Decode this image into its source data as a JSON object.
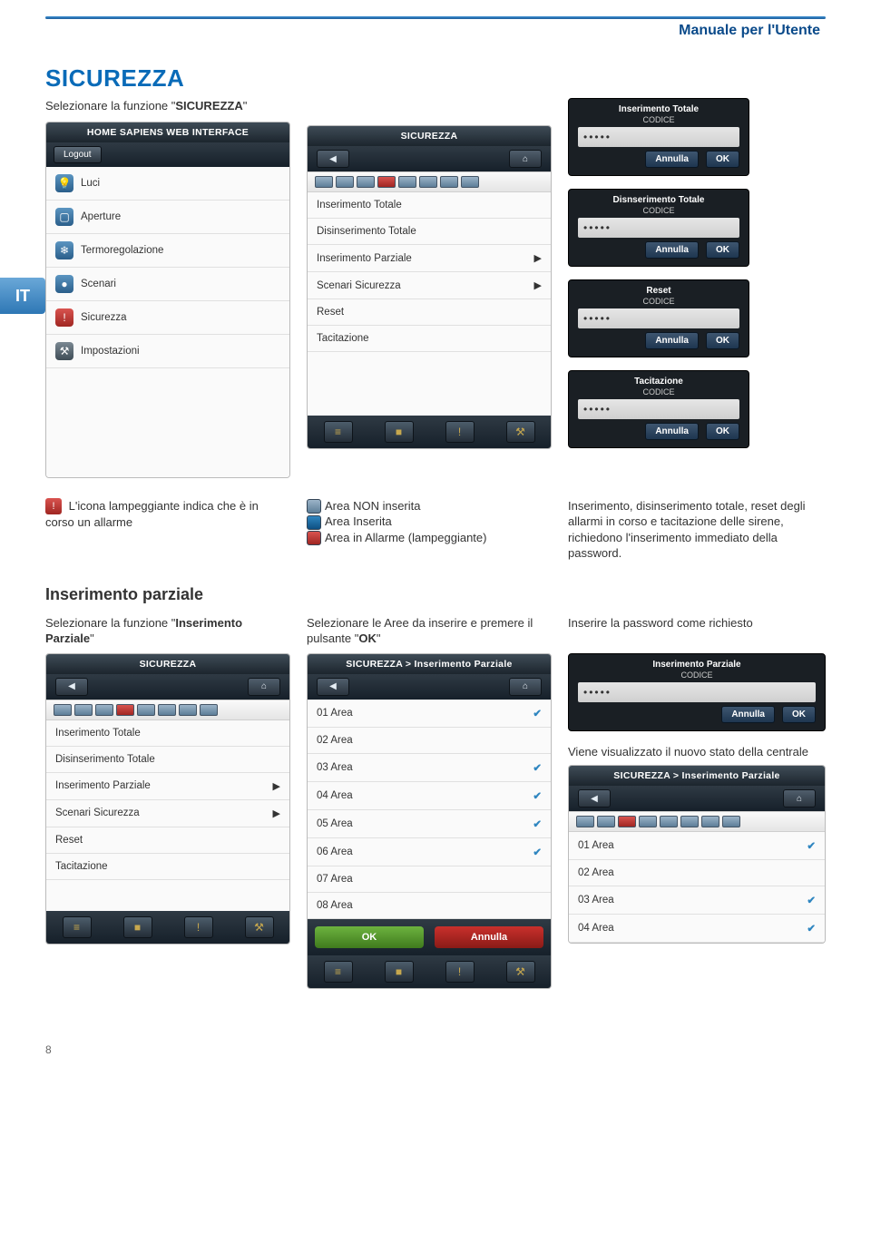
{
  "header": {
    "breadcrumb": "Manuale per l'Utente"
  },
  "title": "SICUREZZA",
  "lang_tab": "IT",
  "intro": {
    "pre": "Selezionare la funzione \"",
    "func": "SICUREZZA",
    "post": "\""
  },
  "main_panel": {
    "title": "HOME SAPIENS WEB INTERFACE",
    "logout": "Logout",
    "menu": [
      "Luci",
      "Aperture",
      "Termoregolazione",
      "Scenari",
      "Sicurezza",
      "Impostazioni"
    ]
  },
  "security_panel": {
    "title": "SICUREZZA",
    "items": [
      {
        "label": "Inserimento Totale",
        "dot": "red"
      },
      {
        "label": "Disinserimento Totale",
        "dot": "red"
      },
      {
        "label": "Inserimento Parziale",
        "arrow": true
      },
      {
        "label": "Scenari Sicurezza",
        "arrow": true
      },
      {
        "label": "Reset",
        "dot": "red"
      },
      {
        "label": "Tacitazione",
        "dot": "red"
      }
    ]
  },
  "codeboxes": [
    {
      "title": "Inserimento Totale",
      "sub": "CODICE",
      "cancel": "Annulla",
      "ok": "OK"
    },
    {
      "title": "Disnserimento Totale",
      "sub": "CODICE",
      "cancel": "Annulla",
      "ok": "OK"
    },
    {
      "title": "Reset",
      "sub": "CODICE",
      "cancel": "Annulla",
      "ok": "OK"
    },
    {
      "title": "Tacitazione",
      "sub": "CODICE",
      "cancel": "Annulla",
      "ok": "OK"
    }
  ],
  "blink_note": "L'icona lampeggiante indica che è in corso un allarme",
  "legend": {
    "off": "Area NON inserita",
    "on": "Area Inserita",
    "alarm": "Area in Allarme (lampeggiante)"
  },
  "explain": "Inserimento, disinserimento totale, reset degli allarmi in corso e tacitazione delle sirene, richiedono l'inserimento immediato della password.",
  "parziale": {
    "heading": "Inserimento parziale",
    "left_cap": {
      "pre": "Selezionare la funzione \"",
      "func": "Inserimento Parziale",
      "post": "\""
    },
    "mid_cap": {
      "pre": "Selezionare le Aree da inserire e premere il pulsante \"",
      "btn": "OK",
      "post": "\""
    },
    "right_cap": "Inserire la password come richiesto",
    "result_cap": "Viene visualizzato il nuovo stato della centrale",
    "panel_left": {
      "title": "SICUREZZA",
      "items": [
        "Inserimento Totale",
        "Disinserimento Totale",
        "Inserimento Parziale",
        "Scenari Sicurezza",
        "Reset",
        "Tacitazione"
      ]
    },
    "panel_mid": {
      "title": "SICUREZZA > Inserimento Parziale",
      "areas": [
        {
          "label": "01 Area",
          "checked": true
        },
        {
          "label": "02 Area",
          "checked": false
        },
        {
          "label": "03 Area",
          "checked": true
        },
        {
          "label": "04 Area",
          "checked": true
        },
        {
          "label": "05 Area",
          "checked": true
        },
        {
          "label": "06 Area",
          "checked": true
        },
        {
          "label": "07 Area",
          "checked": false
        },
        {
          "label": "08 Area",
          "checked": false
        }
      ],
      "ok": "OK",
      "cancel": "Annulla"
    },
    "codebox": {
      "title": "Inserimento Parziale",
      "sub": "CODICE",
      "cancel": "Annulla",
      "ok": "OK"
    },
    "panel_result": {
      "title": "SICUREZZA > Inserimento Parziale",
      "areas": [
        {
          "label": "01 Area",
          "checked": true
        },
        {
          "label": "02 Area",
          "checked": false
        },
        {
          "label": "03 Area",
          "checked": true
        },
        {
          "label": "04 Area",
          "checked": true
        }
      ]
    }
  },
  "page_number": "8"
}
